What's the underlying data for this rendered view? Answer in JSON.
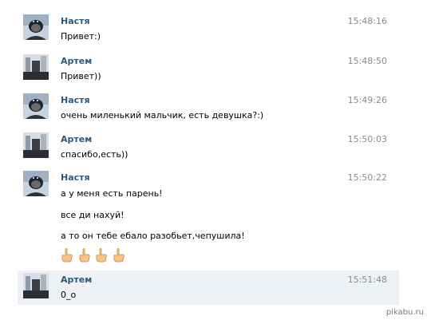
{
  "messages": [
    {
      "name": "Настя",
      "time": "15:48:16",
      "lines": [
        "Привет:)"
      ]
    },
    {
      "name": "Артем",
      "time": "15:48:50",
      "lines": [
        "Привет))"
      ]
    },
    {
      "name": "Настя",
      "time": "15:49:26",
      "lines": [
        "очень миленький мальчик, есть девушка?:)"
      ]
    },
    {
      "name": "Артем",
      "time": "15:50:03",
      "lines": [
        "спасибо,есть))"
      ]
    },
    {
      "name": "Настя",
      "time": "15:50:22",
      "lines": [
        "а у меня есть парень!",
        "все ди нахуй!",
        "а то он тебе ебало разобьет,чепушила!"
      ],
      "emoji": [
        "hand-point-icon",
        "hand-point-icon",
        "hand-point-icon",
        "hand-point-icon"
      ]
    },
    {
      "name": "Артем",
      "time": "15:51:48",
      "lines": [
        "0_o"
      ]
    }
  ],
  "watermark": "pikabu.ru",
  "colors": {
    "name": "#2b587a",
    "time": "#8b8b8b",
    "highlight": "#edf1f5"
  }
}
